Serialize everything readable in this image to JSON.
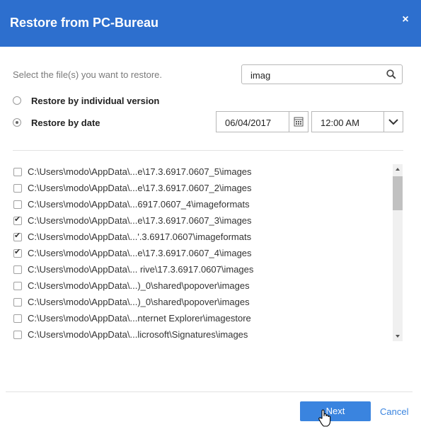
{
  "dialog": {
    "title": "Restore from PC-Bureau",
    "close_label": "×"
  },
  "instruction": "Select the file(s) you want to restore.",
  "search": {
    "value": "imag",
    "placeholder": ""
  },
  "restore_options": [
    {
      "label": "Restore by individual version",
      "selected": false
    },
    {
      "label": "Restore by date",
      "selected": true
    }
  ],
  "date_value": "06/04/2017",
  "time_value": "12:00 AM",
  "files": [
    {
      "path": "C:\\Users\\modo\\AppData\\...e\\17.3.6917.0607_5\\images",
      "checked": false
    },
    {
      "path": "C:\\Users\\modo\\AppData\\...e\\17.3.6917.0607_2\\images",
      "checked": false
    },
    {
      "path": "C:\\Users\\modo\\AppData\\...6917.0607_4\\imageformats",
      "checked": false
    },
    {
      "path": "C:\\Users\\modo\\AppData\\...e\\17.3.6917.0607_3\\images",
      "checked": true
    },
    {
      "path": "C:\\Users\\modo\\AppData\\...'.3.6917.0607\\imageformats",
      "checked": true
    },
    {
      "path": "C:\\Users\\modo\\AppData\\...e\\17.3.6917.0607_4\\images",
      "checked": true
    },
    {
      "path": "C:\\Users\\modo\\AppData\\... rive\\17.3.6917.0607\\images",
      "checked": false
    },
    {
      "path": "C:\\Users\\modo\\AppData\\...)_0\\shared\\popover\\images",
      "checked": false
    },
    {
      "path": "C:\\Users\\modo\\AppData\\...)_0\\shared\\popover\\images",
      "checked": false
    },
    {
      "path": "C:\\Users\\modo\\AppData\\...nternet Explorer\\imagestore",
      "checked": false
    },
    {
      "path": "C:\\Users\\modo\\AppData\\...licrosoft\\Signatures\\images",
      "checked": false
    }
  ],
  "buttons": {
    "next": "Next",
    "cancel": "Cancel"
  },
  "colors": {
    "titlebar": "#2d6fce",
    "primary": "#3a84df",
    "link": "#3a84df"
  },
  "icons": [
    "close-icon",
    "search-icon",
    "calendar-icon",
    "chevron-down-icon",
    "scroll-up-arrow-icon",
    "scroll-down-arrow-icon",
    "hand-cursor-icon"
  ]
}
